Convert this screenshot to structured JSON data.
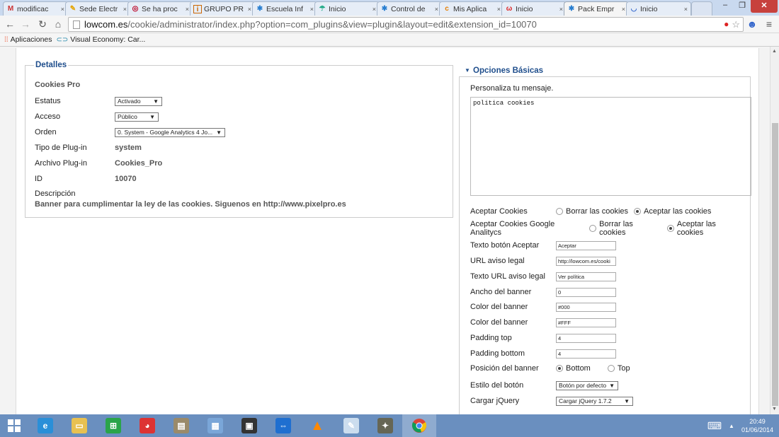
{
  "browser": {
    "tabs": [
      {
        "title": "modificac",
        "icon": "gmail-icon",
        "active": false
      },
      {
        "title": "Sede Electr",
        "icon": "sede-icon",
        "active": false
      },
      {
        "title": "Se ha proc",
        "icon": "proc-icon",
        "active": false
      },
      {
        "title": "GRUPO PR",
        "icon": "grupo-icon",
        "active": false
      },
      {
        "title": "Escuela Inf",
        "icon": "joomla-icon",
        "active": false
      },
      {
        "title": "Inicio",
        "icon": "inicio-icon",
        "active": false
      },
      {
        "title": "Control de",
        "icon": "joomla-icon",
        "active": false
      },
      {
        "title": "Mis Aplica",
        "icon": "cp-icon",
        "active": false
      },
      {
        "title": "Inicio",
        "icon": "inicio2-icon",
        "active": false
      },
      {
        "title": "Pack Empr",
        "icon": "joomla-icon",
        "active": true
      },
      {
        "title": "Inicio",
        "icon": "inicio3-icon",
        "active": false
      }
    ],
    "tab_close": "×",
    "url_host": "lowcom.es",
    "url_path": "/cookie/administrator/index.php?option=com_plugins&view=plugin&layout=edit&extension_id=10070",
    "bookmarks": [
      {
        "label": "Aplicaciones",
        "icon": "apps-grid-icon"
      },
      {
        "label": "Visual Economy: Car...",
        "icon": "visual-economy-icon"
      }
    ]
  },
  "detalles": {
    "legend": "Detalles",
    "title": "Cookies Pro",
    "estatus_label": "Estatus",
    "estatus_value": "Activado",
    "acceso_label": "Acceso",
    "acceso_value": "Público",
    "orden_label": "Orden",
    "orden_value": "0. System - Google Analytics 4 Jo...",
    "tipo_label": "Tipo de Plug-in",
    "tipo_value": "system",
    "archivo_label": "Archivo Plug-in",
    "archivo_value": "Cookies_Pro",
    "id_label": "ID",
    "id_value": "10070",
    "descripcion_label": "Descripción",
    "descripcion_value": "Banner para cumplimentar la ley de las cookies. Siguenos en http://www.pixelpro.es"
  },
  "opciones": {
    "title": "Opciones Básicas",
    "personaliza": "Personaliza tu mensaje.",
    "message": "politica cookies",
    "aceptar_cookies_label": "Aceptar Cookies",
    "aceptar_ga_label": "Aceptar Cookies Google Analitycs",
    "opt_borrar": "Borrar las cookies",
    "opt_aceptar": "Aceptar las cookies",
    "texto_boton_label": "Texto botón Aceptar",
    "texto_boton_value": "Aceptar",
    "url_aviso_label": "URL aviso legal",
    "url_aviso_value": "http://lowcom.es/cooki",
    "texto_url_label": "Texto URL aviso legal",
    "texto_url_value": "Ver política",
    "ancho_label": "Ancho del banner",
    "ancho_value": "0",
    "color1_label": "Color del banner",
    "color1_value": "#000",
    "color2_label": "Color del banner",
    "color2_value": "#FFF",
    "padding_top_label": "Padding top",
    "padding_top_value": "4",
    "padding_bottom_label": "Padding bottom",
    "padding_bottom_value": "4",
    "posicion_label": "Posición del banner",
    "pos_bottom": "Bottom",
    "pos_top": "Top",
    "estilo_label": "Estilo del botón",
    "estilo_value": "Botón por defecto",
    "jquery_label": "Cargar jQuery",
    "jquery_value": "Cargar jQuery 1.7.2"
  },
  "taskbar": {
    "time": "20:49",
    "date": "01/06/2014"
  }
}
